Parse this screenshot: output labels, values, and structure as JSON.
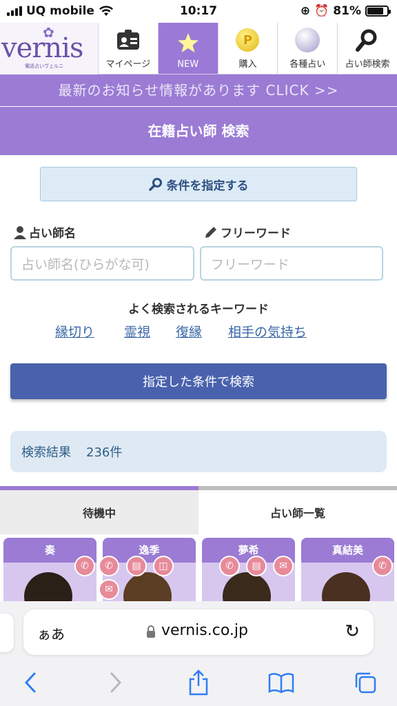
{
  "status": {
    "carrier": "UQ mobile",
    "time": "10:17",
    "battery": "81%",
    "battery_level": 0.81
  },
  "nav": {
    "logo": "vernis",
    "logo_sub": "電話占いヴェルニ",
    "items": [
      {
        "label": "マイページ",
        "icon": "id-card-icon"
      },
      {
        "label": "NEW",
        "icon": "star-icon"
      },
      {
        "label": "購入",
        "icon": "coin-icon",
        "glyph": "P"
      },
      {
        "label": "各種占い",
        "icon": "crystal-ball-icon"
      },
      {
        "label": "占い師検索",
        "icon": "search-icon"
      }
    ]
  },
  "banner": "最新のお知らせ情報があります CLICK >>",
  "page_title": "在籍占い師 検索",
  "conditions_button": "条件を指定する",
  "fortune_teller_label": "占い師名",
  "fortune_teller_placeholder": "占い師名(ひらがな可)",
  "freeword_label": "フリーワード",
  "freeword_placeholder": "フリーワード",
  "keywords_title": "よく検索されるキーワード",
  "keywords": [
    "縁切り",
    "霊視",
    "復縁",
    "相手の気持ち"
  ],
  "search_button": "指定した条件で検索",
  "result": {
    "label": "検索結果",
    "count": "236件"
  },
  "tabs": [
    "待機中",
    "占い師一覧"
  ],
  "cards": [
    {
      "name": "奏"
    },
    {
      "name": "逸季"
    },
    {
      "name": "夢希"
    },
    {
      "name": "真結美"
    }
  ],
  "safari": {
    "text_size": "ぁあ",
    "url": "vernis.co.jp"
  },
  "colors": {
    "purple": "#9b7bd4",
    "blue_button": "#4a62ad",
    "pink_badge": "#e78a9a"
  }
}
